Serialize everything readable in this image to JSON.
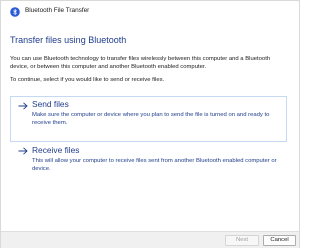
{
  "window": {
    "title": "Bluetooth File Transfer",
    "title_icon": "bluetooth-icon"
  },
  "main": {
    "heading": "Transfer files using Bluetooth",
    "intro": "You can use Bluetooth technology to transfer files wirelessly between this computer and a Bluetooth device, or between this computer and another Bluetooth enabled computer.",
    "prompt": "To continue, select if you would like to send or receive files.",
    "options": [
      {
        "icon": "arrow-right-icon",
        "title": "Send files",
        "description": "Make sure the computer or device where you plan to send the file is turned on and ready to receive them.",
        "selected": true
      },
      {
        "icon": "arrow-right-icon",
        "title": "Receive files",
        "description": "This will allow your computer to receive files sent from another Bluetooth enabled computer or device.",
        "selected": false
      }
    ]
  },
  "footer": {
    "next_label": "Next",
    "next_enabled": false,
    "cancel_label": "Cancel"
  },
  "colors": {
    "link_blue": "#1f3d8c",
    "selection_border": "#c6d9f2",
    "footer_bg": "#f0f0f0"
  }
}
